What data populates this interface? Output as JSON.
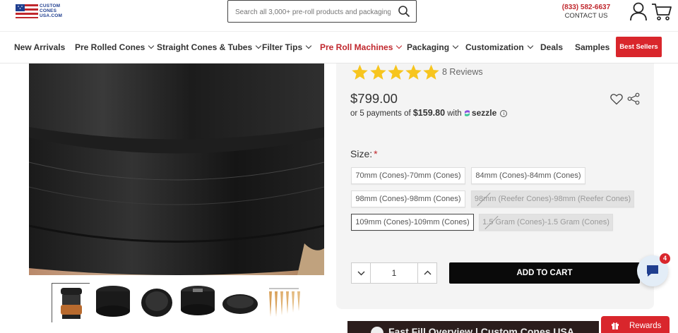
{
  "header": {
    "logo": {
      "line1": "CUSTOM",
      "line2": "CONES",
      "line3": "USA.COM"
    },
    "search_placeholder": "Search all 3,000+ pre-roll products and packaging",
    "phone": "(833) 582-6637",
    "contact_label": "CONTACT US"
  },
  "nav": {
    "items": [
      {
        "label": "New Arrivals",
        "dropdown": false
      },
      {
        "label": "Pre Rolled Cones",
        "dropdown": true
      },
      {
        "label": "Straight Cones & Tubes",
        "dropdown": true
      },
      {
        "label": "Filter Tips",
        "dropdown": true
      },
      {
        "label": "Pre Roll Machines",
        "dropdown": true,
        "highlight": true
      },
      {
        "label": "Packaging",
        "dropdown": true
      },
      {
        "label": "Customization",
        "dropdown": true
      },
      {
        "label": "Deals",
        "dropdown": false
      },
      {
        "label": "Samples",
        "dropdown": false
      }
    ],
    "best_sellers": "Best Sellers"
  },
  "product": {
    "rating_stars": 5,
    "reviews": "8 Reviews",
    "price": "$799.00",
    "payments_prefix": "or 5 payments of",
    "payments_amount": "$159.80",
    "payments_with": "with",
    "payments_provider": "sezzle",
    "size_label": "Size:",
    "required_mark": "*",
    "size_options": [
      {
        "label": "70mm (Cones)-70mm (Cones)",
        "state": "available"
      },
      {
        "label": "84mm (Cones)-84mm (Cones)",
        "state": "available"
      },
      {
        "label": "98mm (Cones)-98mm (Cones)",
        "state": "available"
      },
      {
        "label": "98mm (Reefer Cones)-98mm (Reefer Cones)",
        "state": "unavailable"
      },
      {
        "label": "109mm (Cones)-109mm (Cones)",
        "state": "selected"
      },
      {
        "label": "1.5 Gram (Cones)-1.5 Gram (Cones)",
        "state": "unavailable"
      }
    ],
    "quantity": "1",
    "add_to_cart": "ADD TO CART"
  },
  "chat": {
    "badge_count": "4"
  },
  "video": {
    "title": "Fast Fill Overview | Custom Cones USA"
  },
  "rewards": {
    "label": "Rewards"
  },
  "colors": {
    "brand_red": "#d9262c",
    "star_yellow": "#f7c51e",
    "dark": "#0a0a0a"
  }
}
